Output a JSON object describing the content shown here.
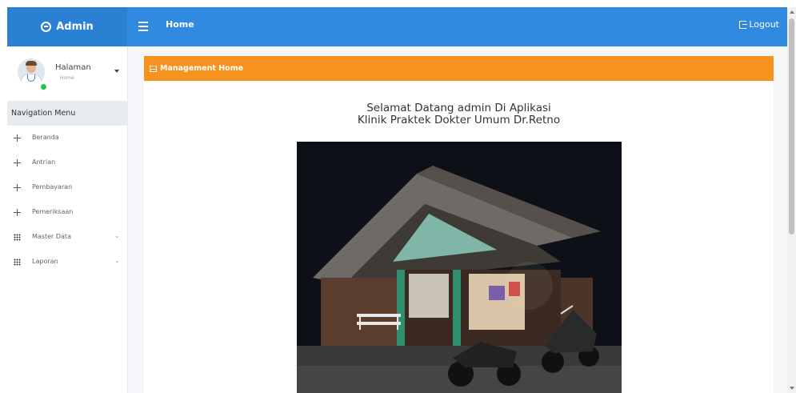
{
  "topbar": {
    "brand": "Admin",
    "brand_icon": "cube-icon",
    "title": "Home",
    "logout": "Logout",
    "color": "#2f8ae0"
  },
  "sidebar": {
    "user": {
      "name": "Halaman",
      "subtitle": "Home"
    },
    "nav_header": "Navigation Menu",
    "items": [
      {
        "label": "Beranda",
        "icon": "move-icon"
      },
      {
        "label": "Antrian",
        "icon": "move-icon"
      },
      {
        "label": "Pembayaran",
        "icon": "move-icon"
      },
      {
        "label": "Pemeriksaan",
        "icon": "move-icon"
      },
      {
        "label": "Master Data",
        "icon": "grid-icon",
        "has_submenu": true
      },
      {
        "label": "Laporan",
        "icon": "grid-icon",
        "has_submenu": true
      }
    ]
  },
  "main": {
    "card_title": "Management Home",
    "card_header_color": "#f7921e",
    "welcome_line1": "Selamat Datang admin Di Aplikasi",
    "welcome_line2": "Klinik Praktek Dokter Umum Dr.Retno"
  }
}
